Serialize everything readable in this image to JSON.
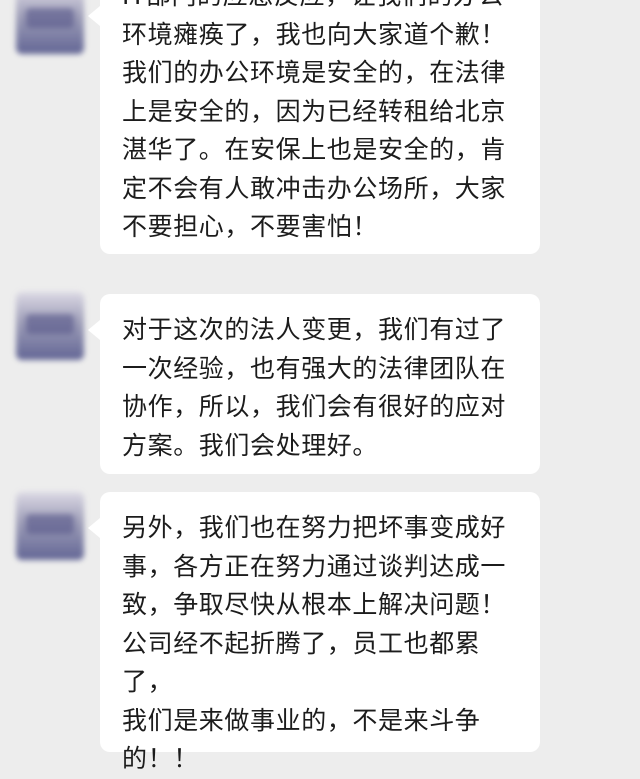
{
  "messages": [
    {
      "text": "IT部门的应急反应，让我们的办公\n环境瘫痪了，我也向大家道个歉！\n我们的办公环境是安全的，在法律\n上是安全的，因为已经转租给北京\n湛华了。在安保上也是安全的，肯\n定不会有人敢冲击办公场所，大家\n不要担心，不要害怕！"
    },
    {
      "text": "对于这次的法人变更，我们有过了\n一次经验，也有强大的法律团队在\n协作，所以，我们会有很好的应对\n方案。我们会处理好。"
    },
    {
      "text": "另外，我们也在努力把坏事变成好\n事，各方正在努力通过谈判达成一\n致，争取尽快从根本上解决问题！\n公司经不起折腾了，员工也都累了，\n我们是来做事业的，不是来斗争\n的！！"
    }
  ]
}
